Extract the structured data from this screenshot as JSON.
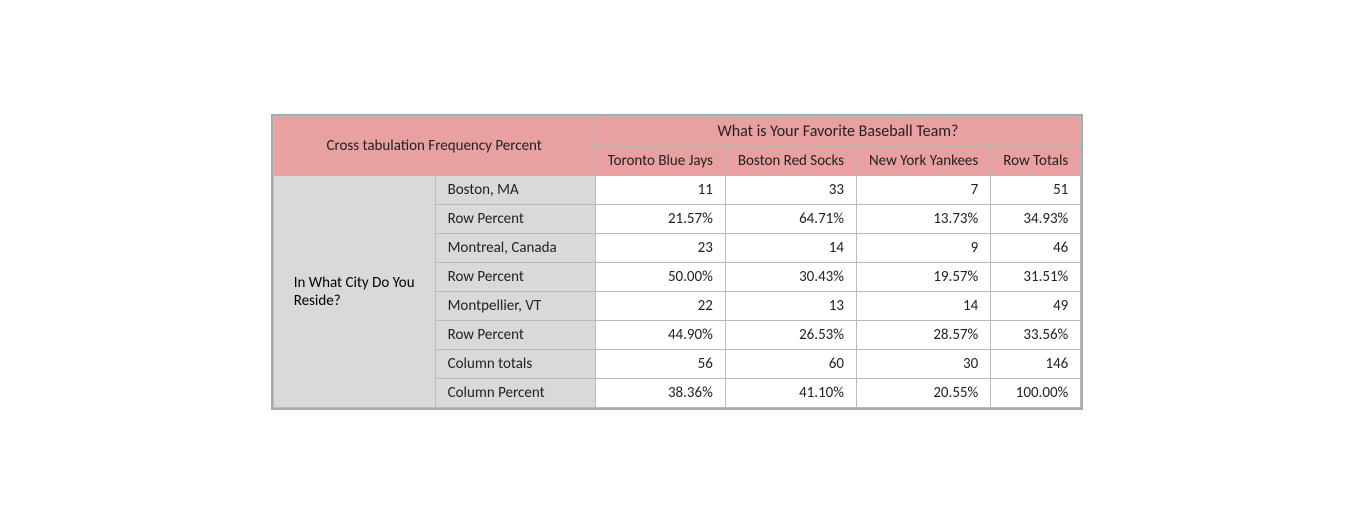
{
  "title": "What is Your Favorite Baseball Team?",
  "col_headers": {
    "row_label_1": "Cross tabulation Frequency Percent",
    "col1": "Toronto Blue Jays",
    "col2": "Boston Red Socks",
    "col3": "New York Yankees",
    "col4": "Row Totals"
  },
  "row_label_main": "In What City Do You Reside?",
  "rows": [
    {
      "label": "Boston, MA",
      "c1": "11",
      "c2": "33",
      "c3": "7",
      "c4": "51"
    },
    {
      "label": "Row Percent",
      "c1": "21.57%",
      "c2": "64.71%",
      "c3": "13.73%",
      "c4": "34.93%"
    },
    {
      "label": "Montreal, Canada",
      "c1": "23",
      "c2": "14",
      "c3": "9",
      "c4": "46"
    },
    {
      "label": "Row Percent",
      "c1": "50.00%",
      "c2": "30.43%",
      "c3": "19.57%",
      "c4": "31.51%"
    },
    {
      "label": "Montpellier, VT",
      "c1": "22",
      "c2": "13",
      "c3": "14",
      "c4": "49"
    },
    {
      "label": "Row Percent",
      "c1": "44.90%",
      "c2": "26.53%",
      "c3": "28.57%",
      "c4": "33.56%"
    },
    {
      "label": "Column totals",
      "c1": "56",
      "c2": "60",
      "c3": "30",
      "c4": "146"
    },
    {
      "label": "Column Percent",
      "c1": "38.36%",
      "c2": "41.10%",
      "c3": "20.55%",
      "c4": "100.00%"
    }
  ]
}
